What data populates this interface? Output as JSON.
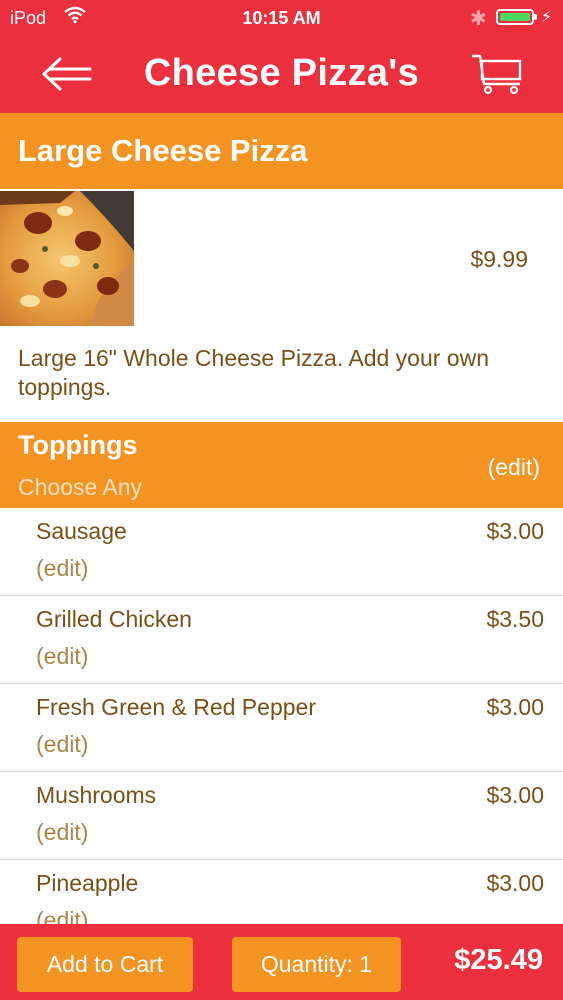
{
  "status_bar": {
    "carrier": "iPod",
    "time": "10:15 AM"
  },
  "nav": {
    "title": "Cheese Pizza's",
    "back_icon": "arrow-left-icon",
    "cart_icon": "shopping-cart-icon"
  },
  "item": {
    "name": "Large Cheese Pizza",
    "price": "$9.99",
    "description": "Large 16\" Whole Cheese Pizza. Add your own toppings."
  },
  "toppings": {
    "title": "Toppings",
    "subtitle": "Choose Any",
    "edit_label": "(edit)",
    "items": [
      {
        "name": "Sausage",
        "edit": "(edit)",
        "price": "$3.00"
      },
      {
        "name": "Grilled Chicken",
        "edit": "(edit)",
        "price": "$3.50"
      },
      {
        "name": "Fresh Green & Red Pepper",
        "edit": "(edit)",
        "price": "$3.00"
      },
      {
        "name": "Mushrooms",
        "edit": "(edit)",
        "price": "$3.00"
      },
      {
        "name": "Pineapple",
        "edit": "(edit)",
        "price": "$3.00"
      }
    ]
  },
  "footer": {
    "add_to_cart": "Add to Cart",
    "quantity": "Quantity: 1",
    "total": "$25.49"
  },
  "colors": {
    "primary_red": "#ec2f3c",
    "accent_orange": "#f39322",
    "text_brown": "#7a5016",
    "battery_green": "#4cd964"
  }
}
